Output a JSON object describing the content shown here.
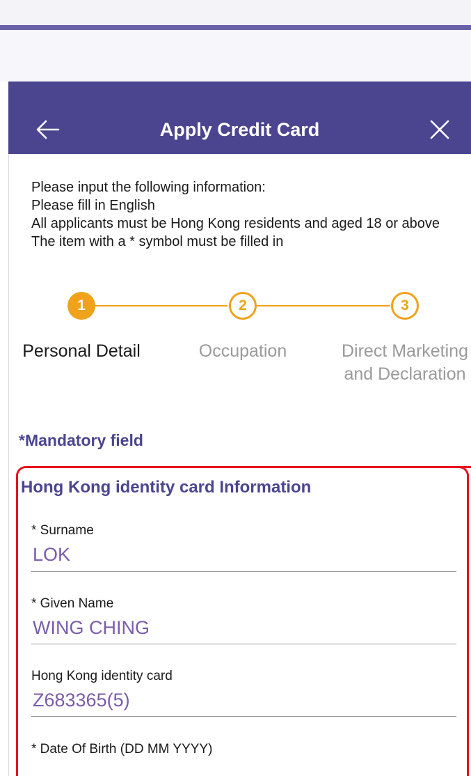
{
  "header": {
    "title": "Apply Credit Card",
    "back_icon": "arrow-left-icon",
    "close_icon": "close-icon"
  },
  "intro": {
    "lines": [
      "Please input the following information:",
      "Please fill in English",
      "All applicants must be Hong Kong residents and aged 18 or above",
      "The item with a * symbol must be filled in"
    ]
  },
  "steps": [
    {
      "number": "1",
      "label": "Personal Detail",
      "state": "active"
    },
    {
      "number": "2",
      "label": "Occupation",
      "state": "idle"
    },
    {
      "number": "3",
      "label": "Direct Marketing and Declaration",
      "state": "idle"
    }
  ],
  "mandatory_note": "*Mandatory field",
  "section": {
    "title": "Hong Kong identity card Information",
    "fields": [
      {
        "label": "* Surname",
        "value": "LOK"
      },
      {
        "label": "* Given Name",
        "value": "WING CHING"
      },
      {
        "label": "Hong Kong identity card",
        "value": "Z683365(5)"
      },
      {
        "label": "* Date Of Birth (DD MM YYYY)",
        "value": ""
      }
    ]
  },
  "colors": {
    "brand": "#4b4590",
    "accent": "#f0a21a",
    "value_text": "#7b5cab",
    "highlight": "#e8121e"
  }
}
